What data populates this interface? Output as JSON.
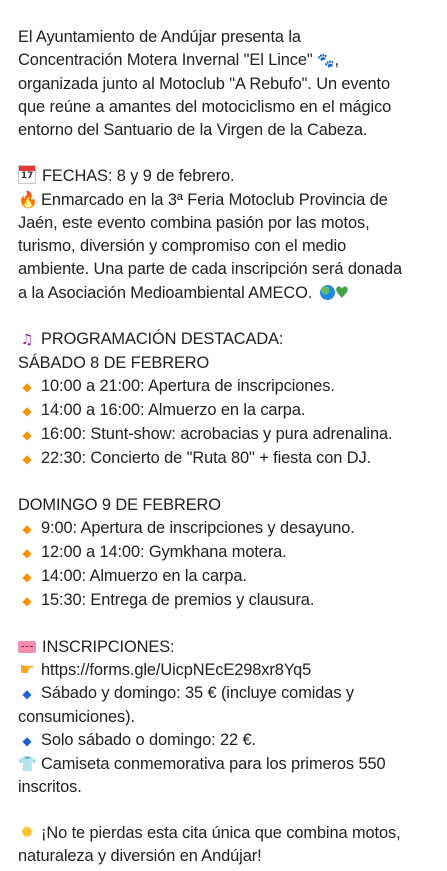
{
  "post": {
    "intro": {
      "l1": "El Ayuntamiento de Andújar presenta la",
      "l2": "Concentración Motera Invernal \"El Lince\"",
      "l2_tail": ",",
      "l3": "organizada junto al Motoclub \"A Rebufo\". Un evento",
      "l4": "que reúne a amantes del motociclismo en el mágico",
      "l5": "entorno del Santuario de la Virgen de la Cabeza."
    },
    "fechas": {
      "icon": "calendar-icon",
      "text": "FECHAS: 8 y 9 de febrero."
    },
    "feria": {
      "icon": "fire-icon",
      "l1": "Enmarcado en la 3ª Feria Motoclub Provincia de",
      "l2": "Jaén, este evento combina pasión por las motos,",
      "l3": "turismo, diversión y compromiso con el medio",
      "l4": "ambiente. Una parte de cada inscripción será donada",
      "l5": "a la Asociación Medioambiental AMECO."
    },
    "programacion": {
      "icon": "music-notes-icon",
      "title": "PROGRAMACIÓN DESTACADA:",
      "sabado_title": "SÁBADO 8 DE FEBRERO",
      "sabado": [
        "10:00 a 21:00: Apertura de inscripciones.",
        "14:00 a 16:00: Almuerzo en la carpa.",
        "16:00: Stunt-show: acrobacias y pura adrenalina.",
        "22:30: Concierto de \"Ruta 80\" + fiesta con DJ."
      ],
      "domingo_title": "DOMINGO 9 DE FEBRERO",
      "domingo": [
        "9:00: Apertura de inscripciones y desayuno.",
        "12:00 a 14:00: Gymkhana motera.",
        "14:00: Almuerzo en la carpa.",
        "15:30: Entrega de premios y clausura."
      ]
    },
    "inscripciones": {
      "icon": "ticket-icon",
      "title": "INSCRIPCIONES:",
      "link": "https://forms.gle/UicpNEcE298xr8Yq5",
      "precio1_l1": "Sábado y domingo: 35 € (incluye comidas y",
      "precio1_l2": "consumiciones).",
      "precio2": "Solo sábado o domingo: 22 €.",
      "camiseta_l1": "Camiseta conmemorativa para los primeros 550",
      "camiseta_l2": "inscritos."
    },
    "cierre": {
      "icon": "sun-icon",
      "l1": "¡No te pierdas esta cita única que combina motos,",
      "l2": "naturaleza y diversión en Andújar!"
    }
  },
  "colors": {
    "text": "#212121",
    "link": "#212121",
    "bullet_orange": "#ff9100",
    "bullet_blue": "#1e63d6"
  }
}
